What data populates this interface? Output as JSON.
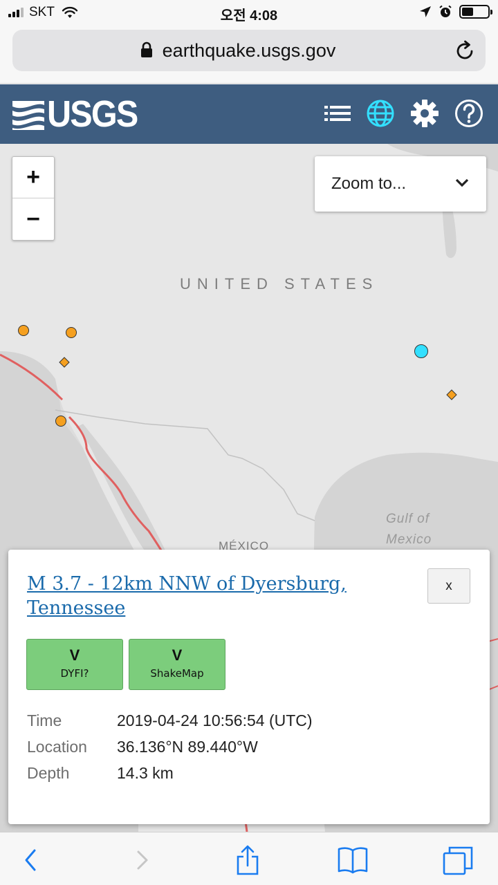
{
  "status_bar": {
    "carrier": "SKT",
    "time": "오전 4:08"
  },
  "browser": {
    "url": "earthquake.usgs.gov"
  },
  "header": {
    "logo_text": "USGS",
    "icons": [
      "list-icon",
      "globe-icon",
      "gear-icon",
      "help-icon"
    ],
    "active_color": "#33e0ff",
    "bg_color": "#3e5d80"
  },
  "map": {
    "zoom_in_label": "+",
    "zoom_out_label": "−",
    "zoom_to_label": "Zoom to...",
    "labels": {
      "country_us": "UNITED STATES",
      "country_mx": "MÉXICO",
      "gulf_line1": "Gulf of",
      "gulf_line2": "Mexico"
    },
    "plate_boundary_color": "#e06060",
    "marker_color": "#f5a020",
    "selected_marker_color": "#33e0ff"
  },
  "popup": {
    "title": "M 3.7 - 12km NNW of Dyersburg, Tennessee",
    "close_label": "x",
    "badges": [
      {
        "value": "V",
        "label": "DYFI?"
      },
      {
        "value": "V",
        "label": "ShakeMap"
      }
    ],
    "badge_color": "#7ccd7c",
    "details": {
      "time_label": "Time",
      "time_value": "2019-04-24 10:56:54 (UTC)",
      "location_label": "Location",
      "location_value": "36.136°N 89.440°W",
      "depth_label": "Depth",
      "depth_value": "14.3 km"
    }
  },
  "toolbar": {
    "icons": [
      "back-icon",
      "forward-icon",
      "share-icon",
      "bookmarks-icon",
      "tabs-icon"
    ],
    "accent_color": "#1a7cf0"
  }
}
